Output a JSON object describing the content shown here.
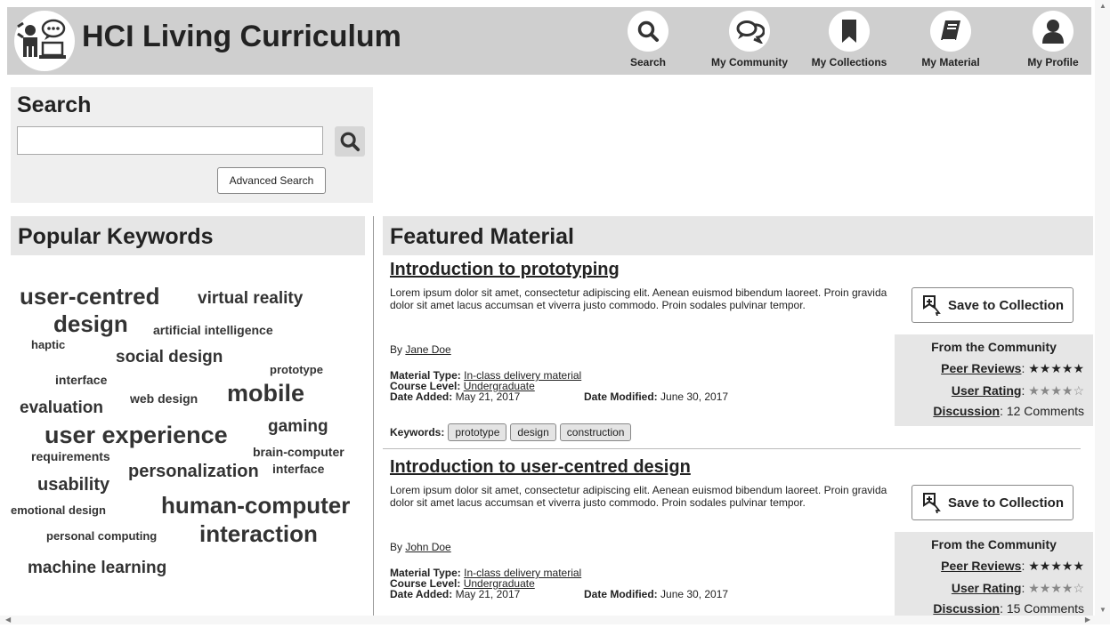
{
  "header": {
    "title": "HCI Living Curriculum",
    "nav": [
      {
        "label": "Search",
        "icon": "search-icon"
      },
      {
        "label": "My Community",
        "icon": "chat-icon"
      },
      {
        "label": "My Collections",
        "icon": "bookmark-icon"
      },
      {
        "label": "My Material",
        "icon": "book-icon"
      },
      {
        "label": "My Profile",
        "icon": "user-icon"
      }
    ]
  },
  "search": {
    "title": "Search",
    "input_value": "",
    "placeholder": "",
    "advanced_label": "Advanced Search"
  },
  "keywords": {
    "title": "Popular Keywords",
    "cloud": [
      "user-centred",
      "virtual reality",
      "design",
      "artificial intelligence",
      "haptic",
      "social design",
      "prototype",
      "interface",
      "web design",
      "mobile",
      "evaluation",
      "gaming",
      "user experience",
      "requirements",
      "brain-computer",
      "interface",
      "personalization",
      "usability",
      "emotional design",
      "human-computer",
      "personal computing",
      "interaction",
      "machine learning"
    ]
  },
  "featured": {
    "title": "Featured Material",
    "save_label": "Save to Collection",
    "labels": {
      "by": "By",
      "material_type": "Material Type:",
      "course_level": "Course Level:",
      "date_added": "Date Added:",
      "date_modified": "Date Modified:",
      "keywords": "Keywords:",
      "community": "From the Community",
      "peer_reviews": "Peer Reviews",
      "user_rating": "User Rating",
      "discussion": "Discussion"
    },
    "items": [
      {
        "title": "Introduction to prototyping",
        "description": "Lorem ipsum dolor sit amet, consectetur adipiscing elit. Aenean euismod bibendum laoreet. Proin gravida dolor sit amet lacus accumsan et viverra justo commodo. Proin sodales pulvinar tempor.",
        "author": "Jane Doe",
        "material_type": "In-class delivery material",
        "course_level": "Undergraduate",
        "date_added": "May 21, 2017",
        "date_modified": "June 30, 2017",
        "keywords": [
          "prototype",
          "design",
          "construction"
        ],
        "peer_reviews_stars": "★★★★★",
        "peer_reviews_rating": 5,
        "user_rating_stars": "★★★★☆",
        "user_rating": 4.5,
        "discussion": "12 Comments"
      },
      {
        "title": "Introduction to user-centred design",
        "description": "Lorem ipsum dolor sit amet, consectetur adipiscing elit. Aenean euismod bibendum laoreet. Proin gravida dolor sit amet lacus accumsan et viverra justo commodo. Proin sodales pulvinar tempor.",
        "author": "John Doe",
        "material_type": "In-class delivery material",
        "course_level": "Undergraduate",
        "date_added": "May 21, 2017",
        "date_modified": "June 30, 2017",
        "keywords": [],
        "peer_reviews_stars": "★★★★★",
        "peer_reviews_rating": 5,
        "user_rating_stars": "★★★★☆",
        "user_rating": 4.5,
        "discussion": "15 Comments"
      }
    ]
  }
}
